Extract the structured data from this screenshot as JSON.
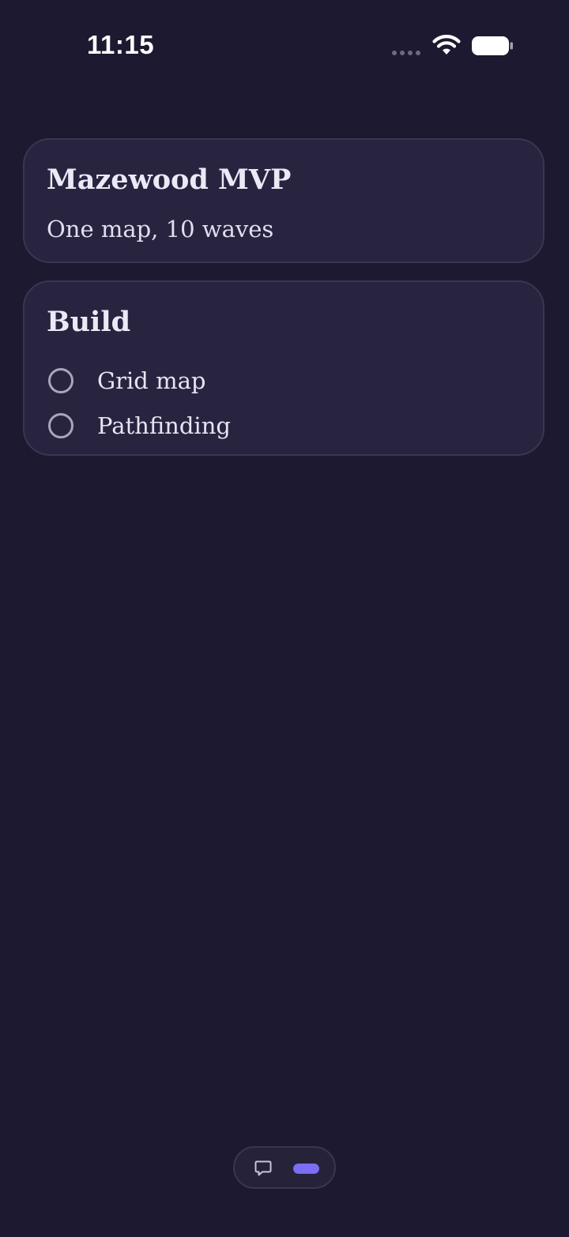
{
  "status_bar": {
    "time": "11:15",
    "icons": [
      "signal-dots-icon",
      "wifi-icon",
      "battery-icon"
    ]
  },
  "project_card": {
    "title": "Mazewood MVP",
    "subtitle": "One map, 10 waves"
  },
  "build_card": {
    "title": "Build",
    "tasks": [
      {
        "label": "Grid map",
        "done": false
      },
      {
        "label": "Pathfinding",
        "done": false
      }
    ]
  },
  "bottom_switcher": {
    "icons": [
      "chat-icon",
      "active-pill-indicator"
    ]
  },
  "colors": {
    "background": "#1c1930",
    "card": "#282440",
    "card_border": "#3a3652",
    "accent": "#7b6ef2",
    "text": "#ece8f6"
  }
}
